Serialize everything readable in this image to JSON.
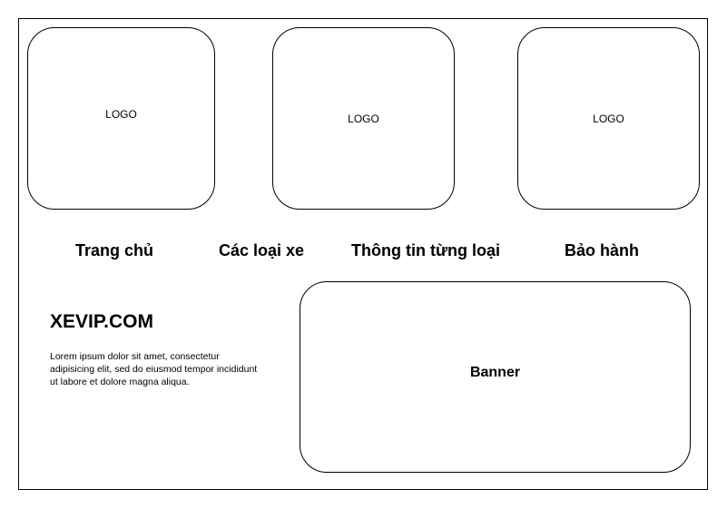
{
  "logos": [
    {
      "label": "LOGO"
    },
    {
      "label": "LOGO"
    },
    {
      "label": "LOGO"
    }
  ],
  "nav": {
    "items": [
      {
        "label": "Trang chủ"
      },
      {
        "label": "Các loại xe"
      },
      {
        "label": "Thông tin từng loại"
      },
      {
        "label": "Bảo hành"
      }
    ]
  },
  "hero": {
    "title": "XEVIP.COM",
    "description": "Lorem ipsum dolor sit amet, consectetur adipisicing elit, sed do eiusmod tempor incididunt ut labore et dolore magna aliqua."
  },
  "banner": {
    "label": "Banner"
  }
}
